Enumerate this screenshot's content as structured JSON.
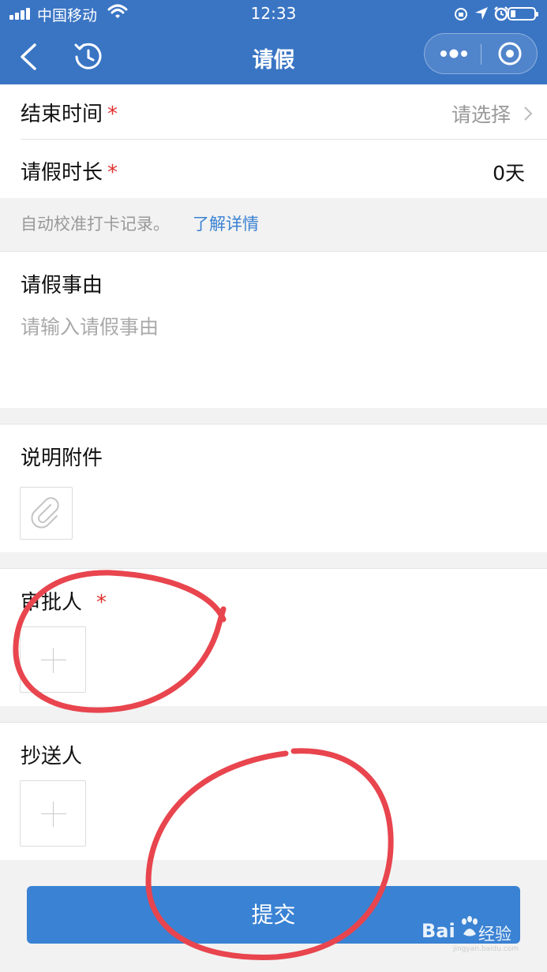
{
  "status_bar": {
    "carrier": "中国移动",
    "time": "12:33"
  },
  "nav": {
    "title": "请假",
    "back_icon": "chevron-left-icon",
    "history_icon": "history-clock-icon",
    "more_icon": "more-dots-icon",
    "close_icon": "target-circle-icon"
  },
  "form": {
    "end_time": {
      "label": "结束时间",
      "required_mark": "*",
      "value": "请选择"
    },
    "duration": {
      "label": "请假时长",
      "required_mark": "*",
      "value": "0天"
    },
    "notice": {
      "text": "自动校准打卡记录。",
      "link": "了解详情"
    },
    "reason": {
      "label": "请假事由",
      "placeholder": "请输入请假事由"
    },
    "attachment": {
      "label": "说明附件",
      "icon": "paperclip-icon"
    },
    "approver": {
      "label": "审批人",
      "required_mark": "*"
    },
    "cc": {
      "label": "抄送人"
    }
  },
  "submit_label": "提交",
  "watermark": {
    "brand": "Bai",
    "brand_suffix": "经验",
    "url": "jingyan.baidu.com"
  },
  "colors": {
    "nav_bg": "#3a75c4",
    "submit_bg": "#3a82d3",
    "required": "#e0312f",
    "link": "#3a82d3",
    "annotation": "#e8454e"
  }
}
